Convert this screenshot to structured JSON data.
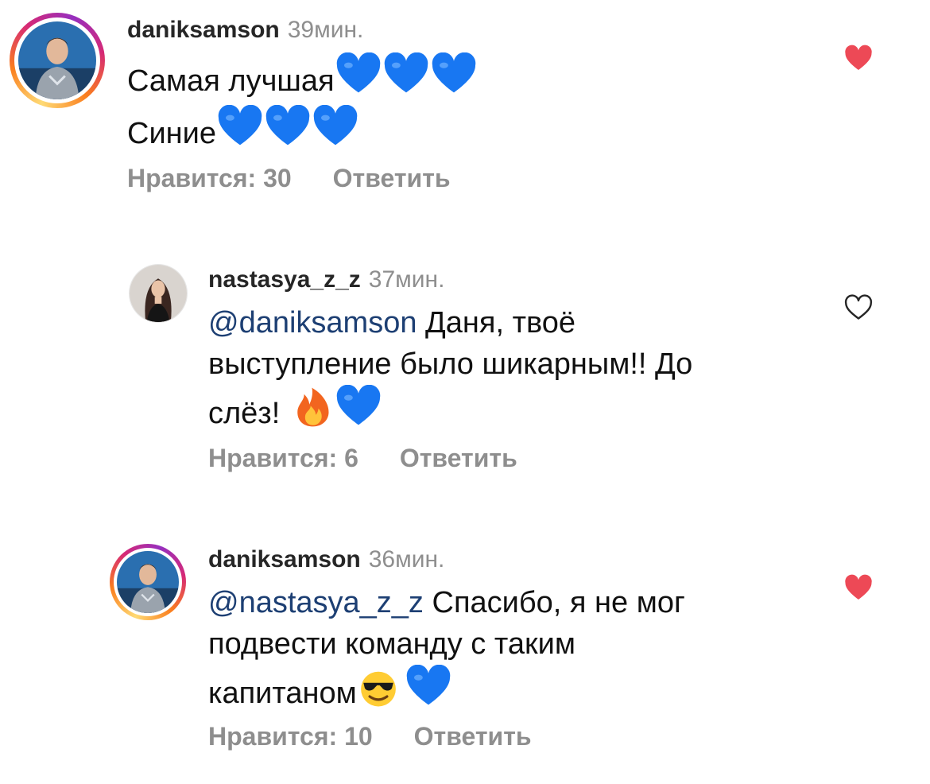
{
  "colors": {
    "liked_heart": "#ed4956",
    "unliked_heart_stroke": "#262626",
    "muted_text": "#8e8e8e",
    "mention": "#1d3f73",
    "blue_heart_emoji": "#1877f2"
  },
  "comments": [
    {
      "username": "daniksamson",
      "time": "39мин.",
      "lines": [
        "Самая лучшая",
        "Синие"
      ],
      "emojis_line1": [
        "blue-heart",
        "blue-heart",
        "blue-heart"
      ],
      "emojis_line2": [
        "blue-heart",
        "blue-heart",
        "blue-heart"
      ],
      "likes_label": "Нравится: 30",
      "reply_label": "Ответить",
      "liked": true,
      "avatar_ring": "story-gradient"
    },
    {
      "username": "nastasya_z_z",
      "time": "37мин.",
      "mention": "@daniksamson",
      "lines": [
        " Даня, твоё",
        "выступление было шикарным!! До",
        "слёз! "
      ],
      "emojis_line3": [
        "fire",
        "blue-heart"
      ],
      "likes_label": "Нравится: 6",
      "reply_label": "Ответить",
      "liked": false,
      "avatar_ring": "none"
    },
    {
      "username": "daniksamson",
      "time": "36мин.",
      "mention": "@nastasya_z_z",
      "lines": [
        " Спасибо, я не мог",
        "подвести команду с таким",
        "капитаном"
      ],
      "emojis_line3": [
        "smiling-face-with-sunglasses",
        "blue-heart"
      ],
      "likes_label": "Нравится: 10",
      "reply_label": "Ответить",
      "liked": true,
      "avatar_ring": "story-gradient"
    }
  ]
}
